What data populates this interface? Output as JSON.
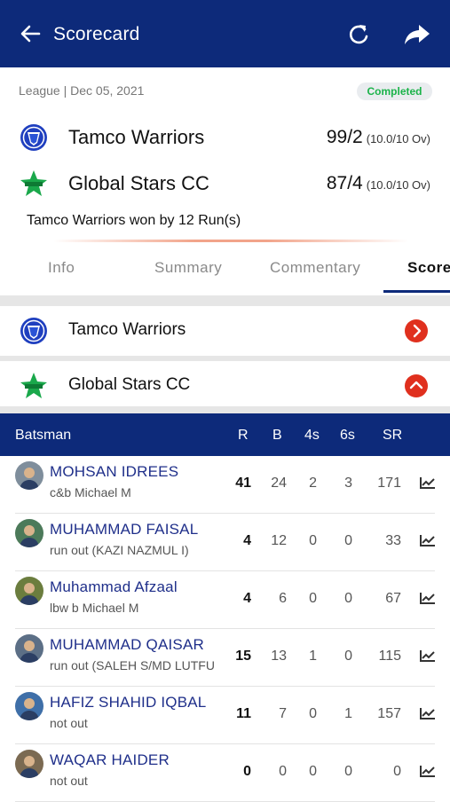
{
  "header": {
    "title": "Scorecard"
  },
  "match": {
    "meta": "League | Dec 05, 2021",
    "status": "Completed",
    "result": "Tamco Warriors won by 12 Run(s)"
  },
  "teams": [
    {
      "name": "Tamco Warriors",
      "score": "99/2",
      "overs": "(10.0/10 Ov)"
    },
    {
      "name": "Global Stars CC",
      "score": "87/4",
      "overs": "(10.0/10 Ov)"
    }
  ],
  "tabs": [
    {
      "label": "Info",
      "active": false
    },
    {
      "label": "Summary",
      "active": false
    },
    {
      "label": "Commentary",
      "active": false
    },
    {
      "label": "Score",
      "active": true
    }
  ],
  "innings": [
    {
      "name": "Tamco Warriors",
      "expanded": false
    },
    {
      "name": "Global Stars CC",
      "expanded": true
    }
  ],
  "batting_table": {
    "columns": [
      "Batsman",
      "R",
      "B",
      "4s",
      "6s",
      "SR"
    ],
    "rows": [
      {
        "name": "MOHSAN IDREES",
        "dismissal": "c&b Michael M",
        "r": "41",
        "b": "24",
        "fours": "2",
        "sixes": "3",
        "sr": "171"
      },
      {
        "name": "MUHAMMAD FAISAL",
        "dismissal": "run out (KAZI NAZMUL I)",
        "r": "4",
        "b": "12",
        "fours": "0",
        "sixes": "0",
        "sr": "33"
      },
      {
        "name": "Muhammad Afzaal",
        "dismissal": "lbw b Michael M",
        "r": "4",
        "b": "6",
        "fours": "0",
        "sixes": "0",
        "sr": "67"
      },
      {
        "name": "MUHAMMAD QAISAR",
        "dismissal": "run out (SALEH S/MD LUTFU",
        "r": "15",
        "b": "13",
        "fours": "1",
        "sixes": "0",
        "sr": "115"
      },
      {
        "name": "HAFIZ SHAHID IQBAL",
        "dismissal": "not out",
        "r": "11",
        "b": "7",
        "fours": "0",
        "sixes": "1",
        "sr": "157"
      },
      {
        "name": "WAQAR HAIDER",
        "dismissal": "not out",
        "r": "0",
        "b": "0",
        "fours": "0",
        "sixes": "0",
        "sr": "0"
      }
    ]
  },
  "colors": {
    "primary": "#0d2a7a",
    "accent_red": "#e0301e",
    "completed_green": "#1bb34a"
  },
  "icons": [
    "back-arrow-icon",
    "refresh-icon",
    "share-icon",
    "tamco-warriors-logo",
    "global-stars-logo",
    "chevron-right-icon",
    "chevron-up-icon",
    "graph-icon"
  ]
}
